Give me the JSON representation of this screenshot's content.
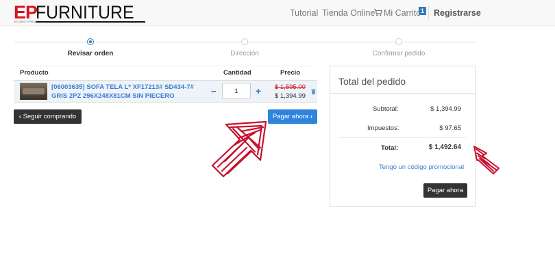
{
  "brand": {
    "ep": "EP",
    "name": "FURNITURE",
    "sub": "ECONO PRECIOS"
  },
  "nav": {
    "tutorial": "Tutorial",
    "tienda": "Tienda Online",
    "carrito": "Mi Carrito",
    "cart_count": "1",
    "registrarse": "Registrarse"
  },
  "steps": [
    {
      "label": "Revisar orden",
      "active": true
    },
    {
      "label": "Dirección",
      "active": false
    },
    {
      "label": "Confirmar pedido",
      "active": false
    }
  ],
  "cart": {
    "headers": {
      "producto": "Producto",
      "cantidad": "Cantidad",
      "precio": "Precio"
    },
    "item": {
      "name": "[06003635] SOFA TELA L* XF17213# SD434-7# GRIS 2PZ 296X248X81CM SIN PIECERO",
      "quantity": "1",
      "price_old": "$ 1,595.00",
      "price_new": "$ 1,394.99"
    },
    "qty_minus": "−",
    "qty_plus": "+"
  },
  "buttons": {
    "seguir": "Seguir comprando",
    "pagar": "Pagar ahora",
    "pagar_summary": "Pagar ahora"
  },
  "summary": {
    "title": "Total del pedido",
    "subtotal_label": "Subtotal:",
    "subtotal_value": "$ 1,394.99",
    "impuestos_label": "Impuestos:",
    "impuestos_value": "$ 97.65",
    "total_label": "Total:",
    "total_value": "$ 1,492.64",
    "promo": "Tengo un código promocional"
  },
  "colors": {
    "accent": "#2e83dd",
    "brand_red": "#d7141f",
    "dark_button": "#333333",
    "annotation": "#c8102e"
  }
}
